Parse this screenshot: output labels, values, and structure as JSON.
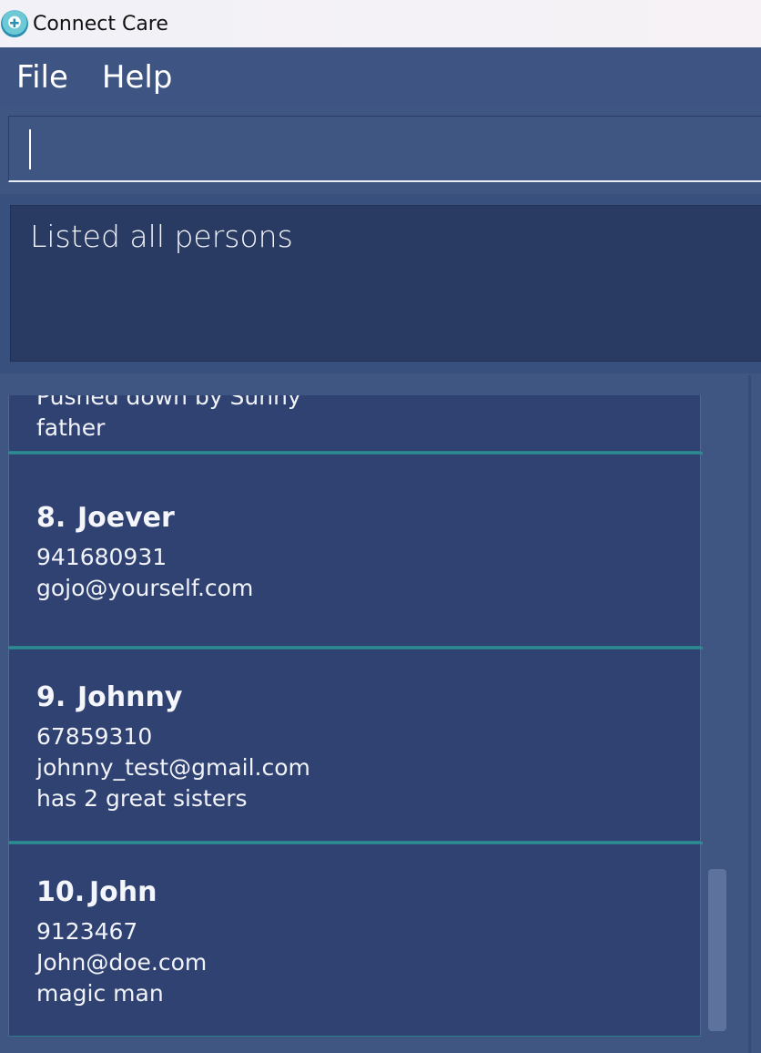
{
  "window": {
    "title": "Connect Care",
    "icon": "app-logo-icon"
  },
  "menu": {
    "file": "File",
    "help": "Help"
  },
  "command": {
    "value": "",
    "placeholder": ""
  },
  "result": {
    "message": "Listed all persons"
  },
  "persons": [
    {
      "lines": [
        "Pushed down by Sunny",
        "father"
      ]
    },
    {
      "index": "8.",
      "name": "Joever",
      "phone": "941680931",
      "email": "gojo@yourself.com"
    },
    {
      "index": "9.",
      "name": "Johnny",
      "phone": "67859310",
      "email": "johnny_test@gmail.com",
      "remark": "has 2 great sisters"
    },
    {
      "index": "10.",
      "name": "John",
      "phone": "9123467",
      "email": "John@doe.com",
      "remark": "magic man"
    }
  ],
  "colors": {
    "background": "#3f5683",
    "card": "#2f4272",
    "accent": "#2e8a93",
    "result_bg": "#293a63"
  }
}
